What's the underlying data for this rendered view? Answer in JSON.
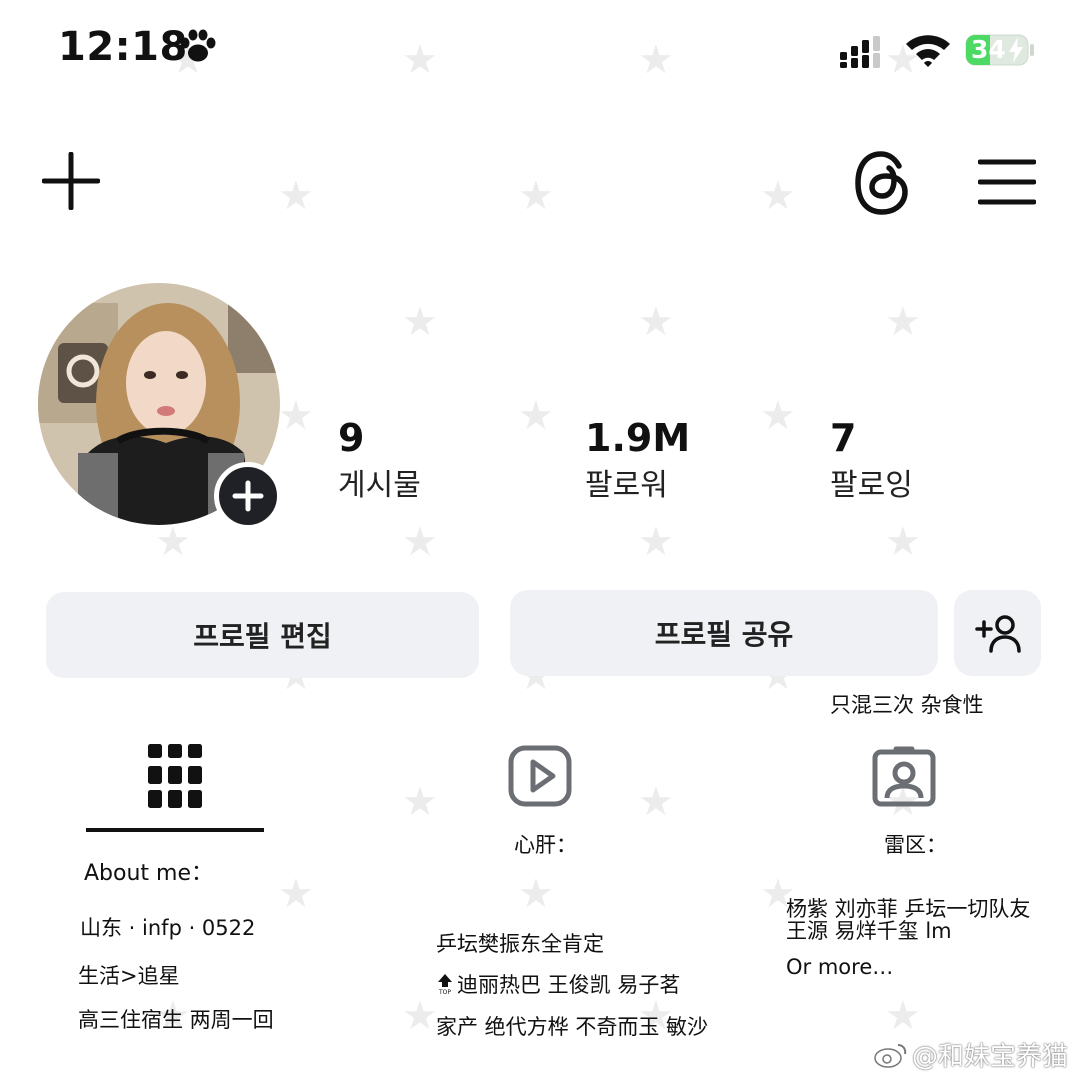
{
  "status_bar": {
    "time": "12:18",
    "battery_level": "34"
  },
  "profile": {
    "posts_count": "9",
    "posts_label": "게시물",
    "followers_count": "1.9M",
    "followers_label": "팔로워",
    "following_count": "7",
    "following_label": "팔로잉"
  },
  "buttons": {
    "edit_profile": "프로필 편집",
    "share_profile": "프로필 공유"
  },
  "notes": {
    "tagline": "只混三次 杂食性",
    "col1_title": "About me：",
    "col1_lines": [
      "山东 · infp · 0522",
      "生活>追星",
      "高三住宿生 两周一回"
    ],
    "col2_title": "心肝：",
    "col2_line1": "乒坛樊振东全肯定",
    "col2_line2": "迪丽热巴 王俊凯 易子茗",
    "col2_line3": "家产 绝代方桦 不奇而玉 敏沙",
    "col3_title": "雷区：",
    "col3_lines": [
      "杨紫 刘亦菲 乒坛一切队友",
      "王源 易烊千玺 lm",
      "Or more…"
    ]
  },
  "watermark": "@和妹宝养猫",
  "icons": [
    "paw-icon",
    "signal-icon",
    "wifi-icon",
    "battery-icon",
    "plus-icon",
    "threads-icon",
    "menu-icon",
    "grid-icon",
    "reels-icon",
    "tagged-icon",
    "add-person-icon",
    "top-icon"
  ],
  "colors": {
    "button_bg": "#eff1f4",
    "battery_green": "#4cd964",
    "dark": "#111111",
    "icon_gray": "#6b6e73"
  }
}
